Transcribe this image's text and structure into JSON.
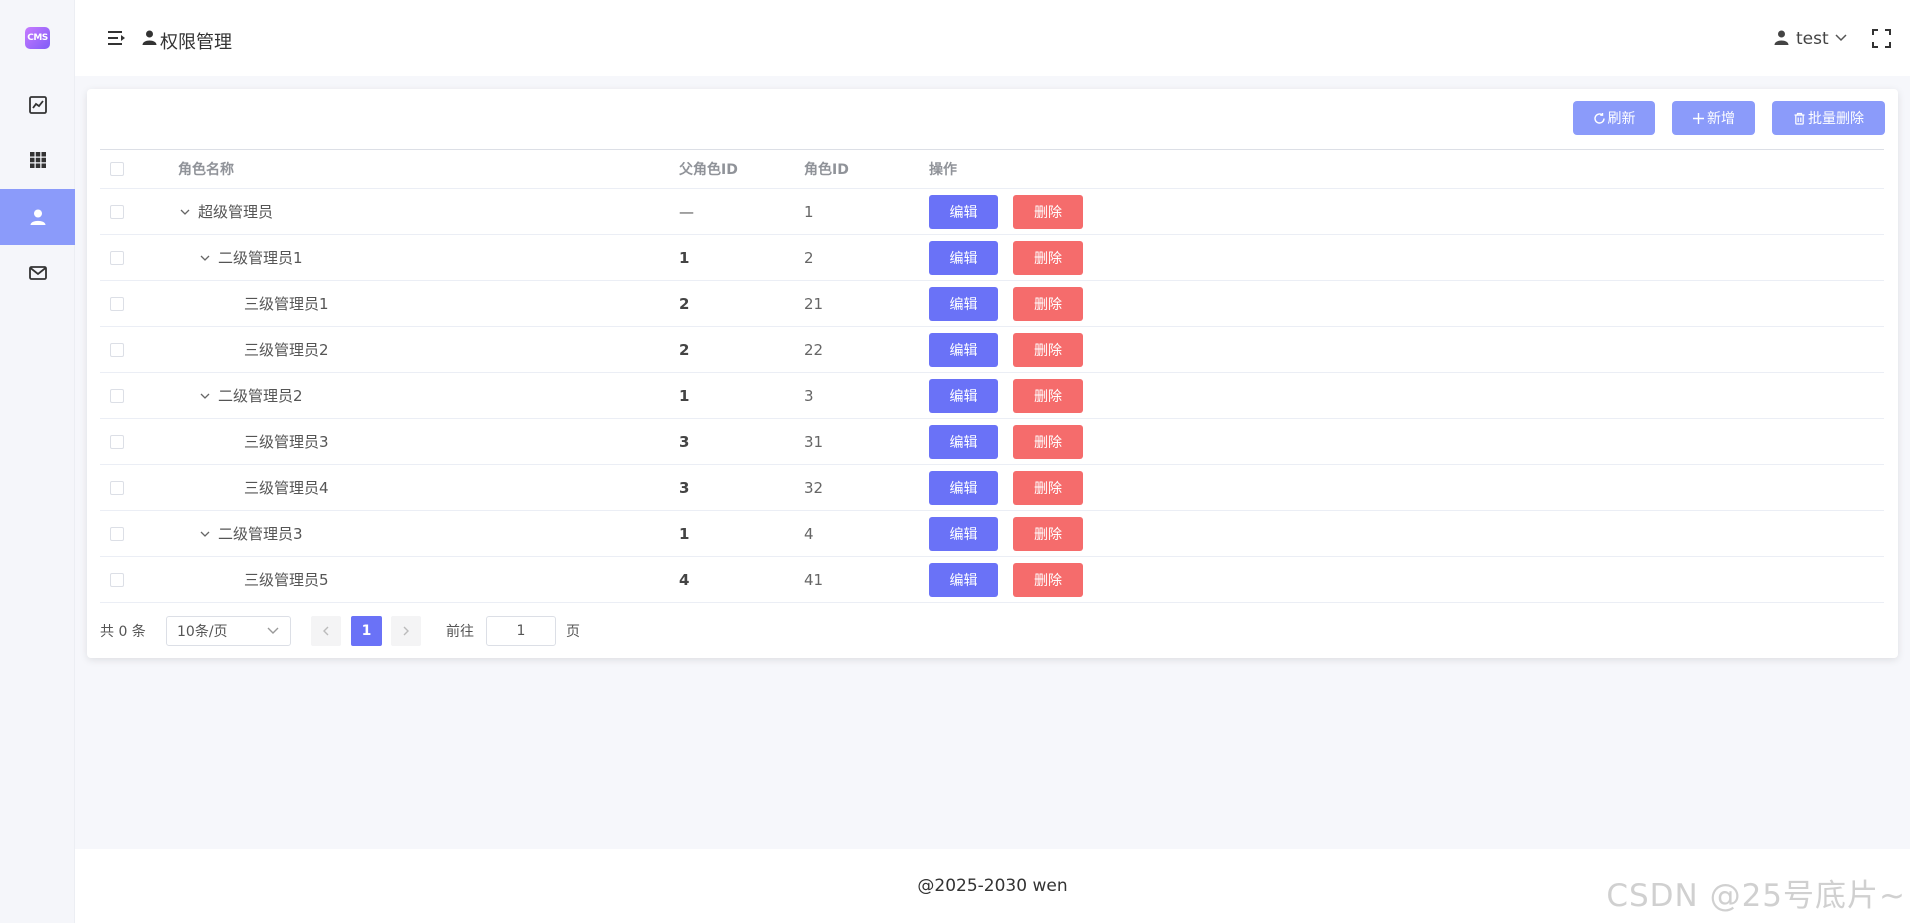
{
  "app": {
    "logo_text": "CMS"
  },
  "sidebar": {
    "items": [
      {
        "icon": "chart-line-icon",
        "active": false
      },
      {
        "icon": "grid-icon",
        "active": false
      },
      {
        "icon": "user-icon",
        "active": true
      },
      {
        "icon": "mail-icon",
        "active": false
      }
    ]
  },
  "header": {
    "title": "权限管理",
    "user": "test"
  },
  "toolbar": {
    "refresh_label": "刷新",
    "add_label": "新增",
    "batch_delete_label": "批量删除"
  },
  "table": {
    "columns": {
      "name": "角色名称",
      "parent_id": "父角色ID",
      "role_id": "角色ID",
      "actions": "操作"
    },
    "rows": [
      {
        "level": 0,
        "expandable": true,
        "name": "超级管理员",
        "parent_id": "—",
        "role_id": "1"
      },
      {
        "level": 1,
        "expandable": true,
        "name": "二级管理员1",
        "parent_id": "1",
        "role_id": "2"
      },
      {
        "level": 2,
        "expandable": false,
        "name": "三级管理员1",
        "parent_id": "2",
        "role_id": "21"
      },
      {
        "level": 2,
        "expandable": false,
        "name": "三级管理员2",
        "parent_id": "2",
        "role_id": "22"
      },
      {
        "level": 1,
        "expandable": true,
        "name": "二级管理员2",
        "parent_id": "1",
        "role_id": "3"
      },
      {
        "level": 2,
        "expandable": false,
        "name": "三级管理员3",
        "parent_id": "3",
        "role_id": "31"
      },
      {
        "level": 2,
        "expandable": false,
        "name": "三级管理员4",
        "parent_id": "3",
        "role_id": "32"
      },
      {
        "level": 1,
        "expandable": true,
        "name": "二级管理员3",
        "parent_id": "1",
        "role_id": "4"
      },
      {
        "level": 2,
        "expandable": false,
        "name": "三级管理员5",
        "parent_id": "4",
        "role_id": "41"
      }
    ],
    "edit_label": "编辑",
    "delete_label": "删除"
  },
  "pagination": {
    "total_text": "共 0 条",
    "page_size": "10条/页",
    "current_page": "1",
    "goto_prefix": "前往",
    "goto_value": "1",
    "goto_suffix": "页"
  },
  "footer": {
    "text": "@2025-2030 wen"
  },
  "watermark": "CSDN @25号底片~",
  "colors": {
    "primary": "#6a72f7",
    "primary_light": "#8b9bfa",
    "danger": "#f56c6c"
  }
}
